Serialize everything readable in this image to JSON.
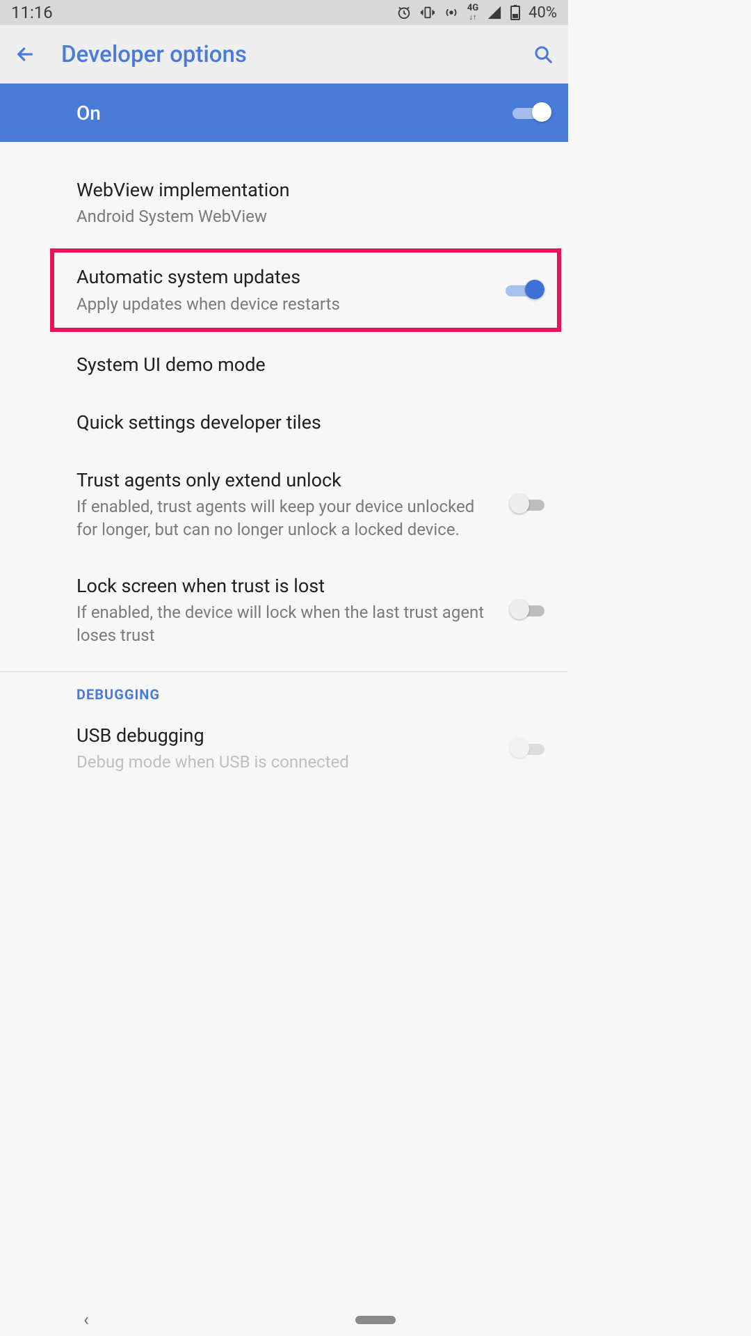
{
  "status": {
    "time": "11:16",
    "battery_pct": "40%"
  },
  "header": {
    "title": "Developer options"
  },
  "master": {
    "label": "On",
    "enabled": true
  },
  "settings": [
    {
      "title": "WebView implementation",
      "sub": "Android System WebView"
    },
    {
      "title": "Automatic system updates",
      "sub": "Apply updates when device restarts",
      "switch": "on",
      "highlighted": true
    },
    {
      "title": "System UI demo mode"
    },
    {
      "title": "Quick settings developer tiles"
    },
    {
      "title": "Trust agents only extend unlock",
      "sub": "If enabled, trust agents will keep your device unlocked for longer, but can no longer unlock a locked device.",
      "switch": "off"
    },
    {
      "title": "Lock screen when trust is lost",
      "sub": "If enabled, the device will lock when the last trust agent loses trust",
      "switch": "off"
    }
  ],
  "section": {
    "label": "DEBUGGING"
  },
  "usb": {
    "title": "USB debugging",
    "sub": "Debug mode when USB is connected",
    "switch": "off"
  }
}
